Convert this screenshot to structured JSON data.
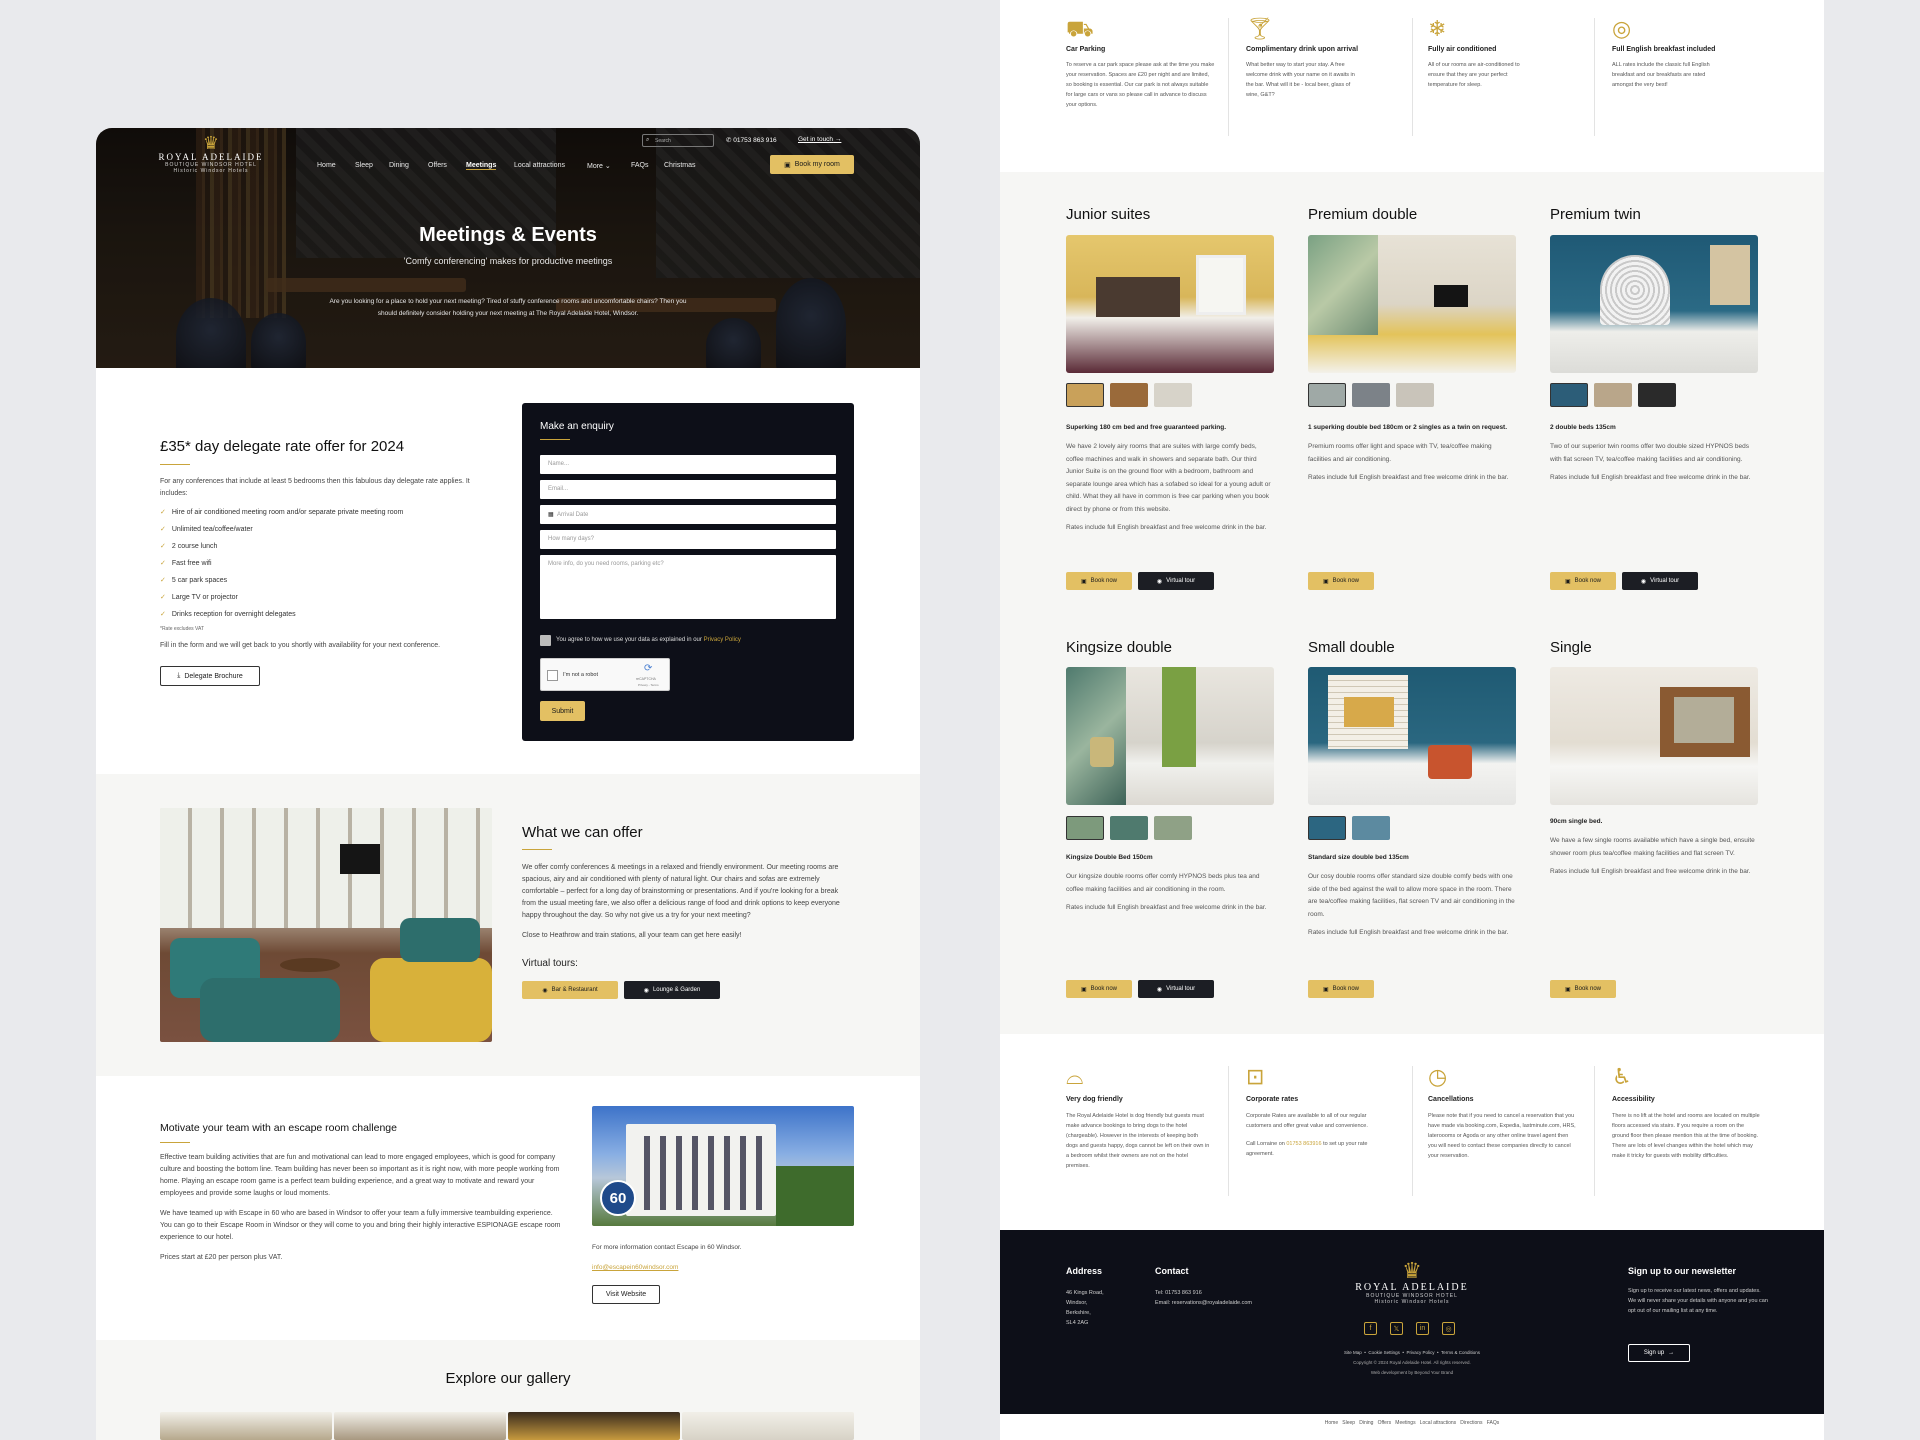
{
  "left": {
    "logo": {
      "name": "ROYAL ADELAIDE",
      "sub": "BOUTIQUE WINDSOR HOTEL",
      "tag": "Historic Windsor Hotels"
    },
    "search_placeholder": "Search",
    "phone": "01753 863 916",
    "get_in_touch": "Get in touch",
    "nav": [
      "Home",
      "Sleep",
      "Dining",
      "Offers",
      "Meetings",
      "Local attractions",
      "More",
      "FAQs",
      "Christmas"
    ],
    "book_room": "Book my room",
    "hero": {
      "title": "Meetings & Events",
      "subtitle": "'Comfy conferencing' makes for productive meetings",
      "text": "Are you looking for a place to hold your next meeting? Tired of stuffy conference rooms and uncomfortable chairs? Then you should definitely consider holding your next meeting at The Royal Adelaide Hotel, Windsor."
    },
    "offer": {
      "title": "£35* day delegate rate offer for 2024",
      "intro": "For any conferences that include at least 5 bedrooms then this fabulous day delegate rate applies. It includes:",
      "items": [
        "Hire of air conditioned meeting room and/or separate private meeting room",
        "Unlimited tea/coffee/water",
        "2 course lunch",
        "Fast free wifi",
        "5 car park spaces",
        "Large TV or projector",
        "Drinks reception for overnight delegates"
      ],
      "note": "*Rate excludes VAT",
      "outro": "Fill in the form and we will get back to you shortly with availability for your next conference.",
      "brochure": "Delegate Brochure"
    },
    "enquiry": {
      "title": "Make an enquiry",
      "name": "Name...",
      "email": "Email...",
      "date": "Arrival Date",
      "days": "How many days?",
      "info": "More info, do you need rooms, parking etc?",
      "consent": "You agree to how we use your data as explained in our",
      "privacy": "Privacy Policy",
      "captcha": "I'm not a robot",
      "captcha_brand": "reCAPTCHA",
      "captcha_links": "Privacy - Terms",
      "submit": "Submit"
    },
    "offer2": {
      "title": "What we can offer",
      "p1": "We offer comfy conferences & meetings in a relaxed and friendly environment. Our meeting rooms are spacious, airy and air conditioned with plenty of natural light. Our chairs and sofas are extremely comfortable – perfect for a long day of brainstorming or presentations. And if you're looking for a break from the usual meeting fare, we also offer a delicious range of food and drink options to keep everyone happy throughout the day. So why not give us a try for your next meeting?",
      "p2": "Close to Heathrow and train stations, all your team can get here easily!",
      "tours_title": "Virtual tours:",
      "tour1": "Bar & Restaurant",
      "tour2": "Lounge & Garden"
    },
    "escape": {
      "title": "Motivate your team with an escape room challenge",
      "p1": "Effective team building activities that are fun and motivational can lead to more engaged employees, which is good for company culture and boosting the bottom line. Team building has never been so important as it is right now, with more people working from home. Playing an escape room game is a perfect team building experience, and a great way to motivate and reward your employees and provide some laughs or loud moments.",
      "p2": "We have teamed up with Escape in 60 who are based in Windsor to offer your team a fully immersive teambuilding experience. You can go to their Escape Room in Windsor or they will come to you and bring their highly interactive ESPIONAGE escape room experience to our hotel.",
      "p3": "Prices start at £20 per person plus VAT.",
      "contact": "For more information contact Escape in 60 Windsor.",
      "email": "info@escapein60windsor.com",
      "visit": "Visit Website",
      "badge": "60"
    },
    "gallery_title": "Explore our gallery"
  },
  "right": {
    "features": [
      {
        "icon": "car-icon",
        "title": "Car Parking",
        "text": "To reserve a car park space please ask at the time you make your reservation. Spaces are £20 per night and are limited, so booking is essential. Our car park is not always suitable for large cars or vans so please call in advance to discuss your options."
      },
      {
        "icon": "drink-icon",
        "title": "Complimentary drink upon arrival",
        "text": "What better way to start your stay. A free welcome drink with your name on it awaits in the bar. What will it be - local beer, glass of wine, G&T?"
      },
      {
        "icon": "aircon-icon",
        "title": "Fully air conditioned",
        "text": "All of our rooms are air-conditioned to ensure that they are your perfect temperature for sleep."
      },
      {
        "icon": "breakfast-icon",
        "title": "Full English breakfast included",
        "text": "ALL rates include the classic full English breakfast and our breakfasts are rated amongst the very best!"
      }
    ],
    "rooms": [
      {
        "title": "Junior suites",
        "bold": "Superking 180 cm bed and free guaranteed parking.",
        "p1": "We have 2 lovely airy rooms that are suites with large comfy beds, coffee machines and walk in showers and separate bath. Our third Junior Suite is on the ground floor with a bedroom, bathroom and separate lounge area which has a sofabed so ideal for a young adult or child. What they all have in common is free car parking when you book direct by phone or from this website.",
        "p2": "Rates include full English breakfast and free welcome drink in the bar.",
        "book": "Book now",
        "tour": "Virtual tour"
      },
      {
        "title": "Premium double",
        "bold": "1 superking double bed 180cm or 2 singles as a twin on request.",
        "p1": "Premium rooms offer light and space with TV, tea/coffee making facilities and air conditioning.",
        "p2": "Rates include full English breakfast and free welcome drink in the bar.",
        "book": "Book now"
      },
      {
        "title": "Premium twin",
        "bold": "2 double beds 135cm",
        "p1": "Two of our superior twin rooms offer two double sized HYPNOS beds with flat screen TV, tea/coffee making facilities and air conditioning.",
        "p2": "Rates include full English breakfast and free welcome drink in the bar.",
        "book": "Book now",
        "tour": "Virtual tour"
      },
      {
        "title": "Kingsize double",
        "bold": "Kingsize Double Bed 150cm",
        "p1": "Our kingsize double rooms offer comfy HYPNOS beds plus tea and coffee making facilities and air conditioning in the room.",
        "p2": "Rates include full English breakfast and free welcome drink in the bar.",
        "book": "Book now",
        "tour": "Virtual tour"
      },
      {
        "title": "Small double",
        "bold": "Standard size double bed 135cm",
        "p1": "Our cosy double rooms offer standard size double comfy beds with one side of the bed against the wall to allow more space in the room. There are tea/coffee making facilities, flat screen TV and air conditioning in the room.",
        "p2": "Rates include full English breakfast and free welcome drink in the bar.",
        "book": "Book now"
      },
      {
        "title": "Single",
        "bold": "90cm single bed.",
        "p1": "We have a few single rooms available which have a single bed, ensuite shower room plus tea/coffee making facilities and flat screen TV.",
        "p2": "Rates include full English breakfast and free welcome drink in the bar.",
        "book": "Book now"
      }
    ],
    "policies": [
      {
        "icon": "dog-bed-icon",
        "title": "Very dog friendly",
        "text": "The Royal Adelaide Hotel is dog friendly but guests must make advance bookings to bring dogs to the hotel (chargeable). However in the interests of keeping both dogs and guests happy, dogs cannot be left on their own in a bedroom whilst their owners are not on the hotel premises."
      },
      {
        "icon": "briefcase-icon",
        "title": "Corporate rates",
        "text": "Corporate Rates are available to all of our regular customers and offer great value and convenience.",
        "text2": "Call Lorraine on",
        "phone": "01753 863916",
        "text3": "to set up your rate agreement."
      },
      {
        "icon": "clock-icon",
        "title": "Cancellations",
        "text": "Please note that if you need to cancel a reservation that you have made via booking.com, Expedia, lastminute.com, HRS, lateroooms or Agoda or any other online travel agent then you will need to contact these companies directly to cancel your reservation."
      },
      {
        "icon": "accessibility-icon",
        "title": "Accessibility",
        "text": "There is no lift at the hotel and rooms are located on multiple floors accessed via stairs. If you require a room on the ground floor then please mention this at the time of booking. There are lots of level changes within the hotel which may make it tricky for guests with mobility difficulties."
      }
    ],
    "footer": {
      "address_title": "Address",
      "address": [
        "46 Kings Road,",
        "Windsor,",
        "Berkshire,",
        "SL4 2AG"
      ],
      "contact_title": "Contact",
      "tel": "Tel: 01753 863 916",
      "email": "Email: reservations@royaladelaide.com",
      "links": "Site Map  •  Cookie Settings  •  Privacy Policy  •  Terms & Conditions",
      "copyright": "Copyright © 2024 Royal Adelaide Hotel. All rights reserved.",
      "dev": "Web development by Beyond Your Brand",
      "news_title": "Sign up to our newsletter",
      "news_text": "Sign up to receive our latest news, offers and updates. We will never share your details with anyone and you can opt out of our mailing list at any time.",
      "signup": "Sign up"
    },
    "bottom_nav": "Home   Sleep   Dining   Offers   Meetings   Local attractions   Directions   FAQs"
  }
}
